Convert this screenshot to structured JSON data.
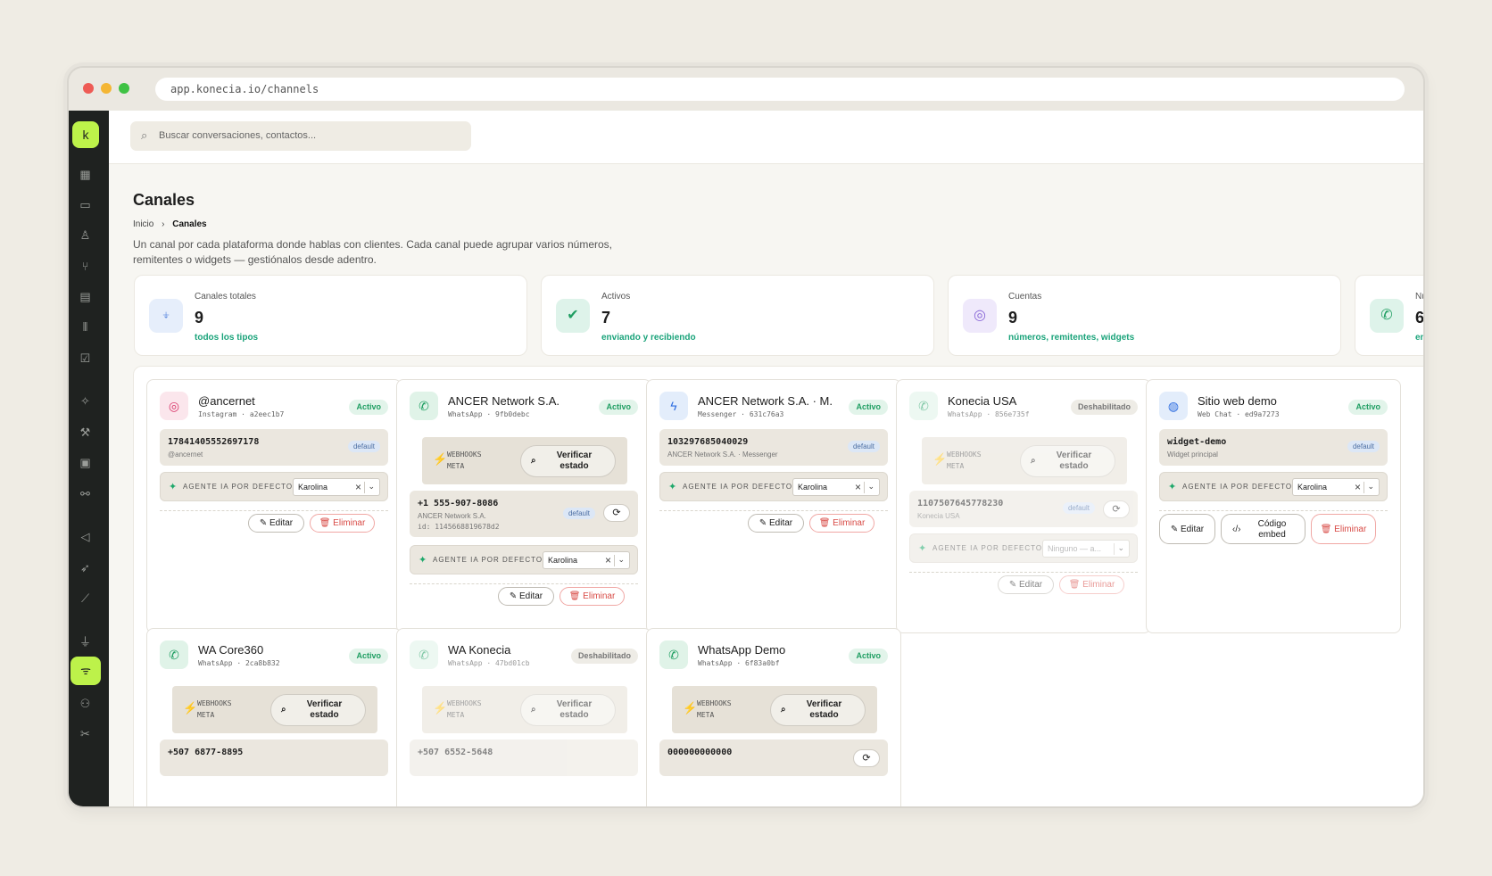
{
  "browser": {
    "url": "app.konecia.io/channels"
  },
  "logo": "k",
  "nav_icons": [
    "grid-icon",
    "inbox-icon",
    "user-icon",
    "flow-icon",
    "contacts-icon",
    "pipeline-icon",
    "tasks-icon",
    "magic-icon",
    "tools-icon",
    "knowledge-icon",
    "integrations-icon",
    "campaigns-icon",
    "rocket-icon",
    "analytics-icon",
    "plug-icon",
    "channels-icon",
    "team-icon",
    "settings-icon"
  ],
  "search": {
    "placeholder": "Buscar conversaciones, contactos..."
  },
  "page": {
    "title": "Canales",
    "breadcrumb_home": "Inicio",
    "breadcrumb_sep": "›",
    "breadcrumb_current": "Canales",
    "description": "Un canal por cada plataforma donde hablas con clientes. Cada canal puede agrupar varios números, remitentes o widgets — gestiónalos desde adentro."
  },
  "stats": [
    {
      "label": "Canales totales",
      "value": "9",
      "sub": "todos los tipos",
      "icon": "antenna-icon",
      "color": "#e6eefb"
    },
    {
      "label": "Activos",
      "value": "7",
      "sub": "enviando y recibiendo",
      "icon": "check-icon",
      "color": "#def3ea"
    },
    {
      "label": "Cuentas",
      "value": "9",
      "sub": "números, remitentes, widgets",
      "icon": "fingerprint-icon",
      "color": "#efe9fb"
    },
    {
      "label": "Nú",
      "value": "6",
      "sub": "en",
      "icon": "whatsapp-icon",
      "color": "#def3ea"
    }
  ],
  "labels": {
    "default": "default",
    "webhooks": "WEBHOOKS\nMETA",
    "verify": "Verificar estado",
    "agent": "AGENTE IA POR DEFECTO",
    "edit": "Editar",
    "delete": "Eliminar",
    "embed": "Código embed"
  },
  "cards": [
    {
      "name": "@ancernet",
      "type": "Instagram",
      "id": "a2eec1b7",
      "status": "Activo",
      "number": "17841405552697178",
      "sub": "@ancernet",
      "agent": "Karolina"
    },
    {
      "name": "ANCER Network S.A.",
      "type": "WhatsApp",
      "id": "9fb0debc",
      "status": "Activo",
      "number": "+1 555-907-8086",
      "sub": "ANCER Network S.A.",
      "extra": "id: 1145668819678d2",
      "agent": "Karolina"
    },
    {
      "name": "ANCER Network S.A. · M...",
      "type": "Messenger",
      "id": "631c76a3",
      "status": "Activo",
      "number": "103297685040029",
      "sub": "ANCER Network S.A. · Messenger",
      "agent": "Karolina"
    },
    {
      "name": "Konecia USA",
      "type": "WhatsApp",
      "id": "856e735f",
      "status": "Deshabilitado",
      "number": "1107507645778230",
      "sub": "Konecia USA",
      "agent": "Ninguno — a..."
    },
    {
      "name": "Sitio web demo",
      "type": "Web Chat",
      "id": "ed9a7273",
      "status": "Activo",
      "number": "widget-demo",
      "sub": "Widget principal",
      "agent": "Karolina"
    },
    {
      "name": "WA Core360",
      "type": "WhatsApp",
      "id": "2ca8b832",
      "status": "Activo",
      "number": "+507 6877-8895"
    },
    {
      "name": "WA Konecia",
      "type": "WhatsApp",
      "id": "47bd01cb",
      "status": "Deshabilitado",
      "number": "+507 6552-5648"
    },
    {
      "name": "WhatsApp Demo",
      "type": "WhatsApp",
      "id": "6f83a0bf",
      "status": "Activo",
      "number": "000000000000"
    }
  ]
}
